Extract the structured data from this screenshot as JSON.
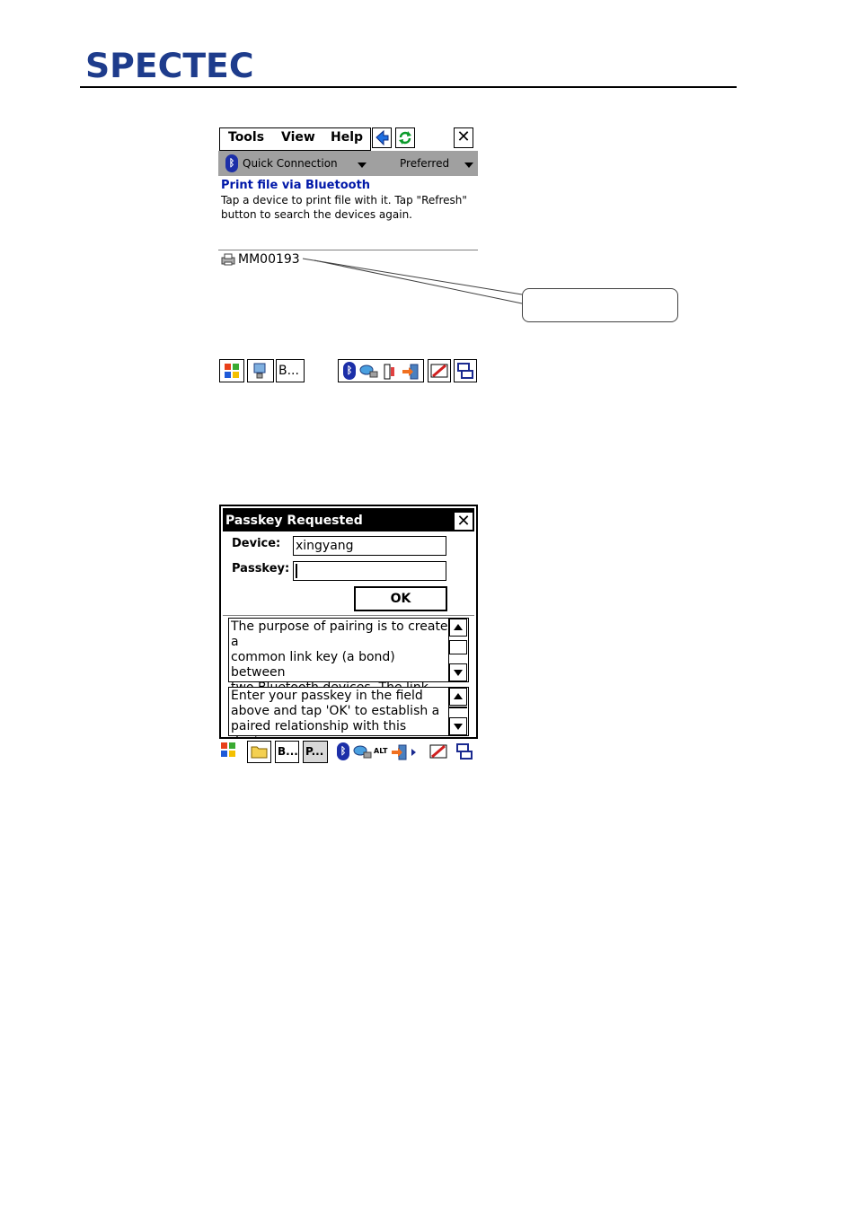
{
  "logo": "SPECTEC",
  "screen1": {
    "menu": [
      "Tools",
      "View",
      "Help"
    ],
    "close_glyph": "✕",
    "toolbar": {
      "connection": "Quick Connection",
      "filter": "Preferred"
    },
    "title": "Print file via Bluetooth",
    "description": "Tap a device to print file with it. Tap \"Refresh\" button to search the devices again.",
    "device": "MM00193",
    "taskbar_label": "B..."
  },
  "screen2": {
    "dialog_title": "Passkey Requested",
    "close_glyph": "✕",
    "device_label": "Device:",
    "device_value": "xingyang",
    "passkey_label": "Passkey:",
    "passkey_value": "",
    "ok_label": "OK",
    "info1": "The purpose of pairing is to create a\ncommon link key (a bond) between\ntwo Bluetooth devices. The link key\nis used in all future connections to",
    "info2": "Enter your passkey in the field\nabove and tap 'OK' to establish a\npaired relationship with this device.",
    "taskbar": [
      "B...",
      "P...",
      "ALT"
    ]
  },
  "icons": {
    "bluetooth": "bluetooth-icon",
    "back": "back-arrow-icon",
    "refresh": "refresh-icon",
    "windows": "windows-logo-icon"
  },
  "colors": {
    "brand": "#1e3c8c",
    "title_blue": "#0018a8",
    "toolbar_gray": "#a0a0a0",
    "bt_blue": "#1c2fa8"
  }
}
